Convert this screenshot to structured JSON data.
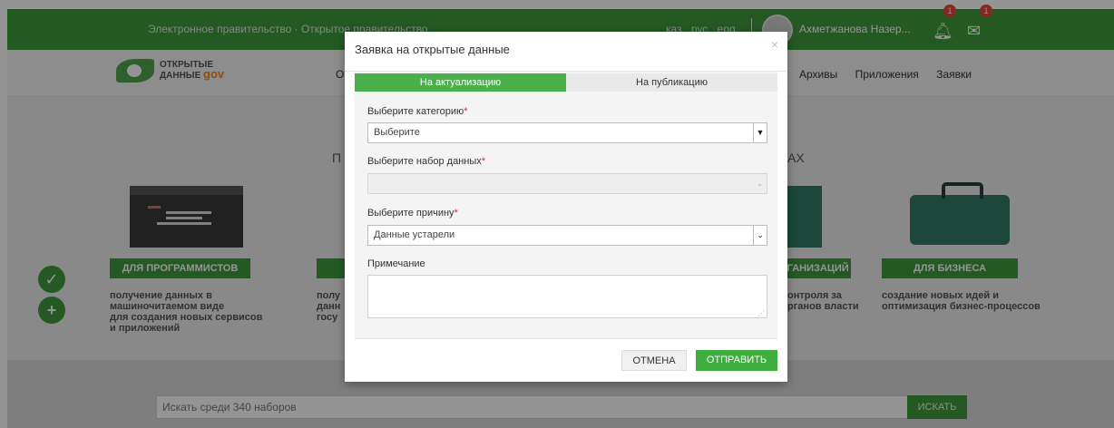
{
  "topbar": {
    "gov_text": "Электронное правительство · Открытое правительство",
    "langs": [
      "каз",
      "рус",
      "eng"
    ],
    "user_name": "Ахметжанова Назер...",
    "notifications_count": "1",
    "messages_count": "1"
  },
  "navbar": {
    "logo_line1": "ОТКРЫТЫЕ",
    "logo_line2": "ДАННЫЕ",
    "logo_suffix": "gov",
    "partial_item": "О",
    "items": [
      "Архивы",
      "Приложения",
      "Заявки"
    ]
  },
  "hero": {
    "partial_left": "П",
    "partial_right": "АХ",
    "cards": [
      {
        "label": "ДЛЯ ПРОГРАММИСТОВ",
        "desc": [
          "получение данных в",
          "машиночитаемом виде",
          "для создания новых сервисов",
          "и приложений"
        ]
      },
      {
        "label": "",
        "desc": [
          "полу",
          "данн",
          "госу"
        ]
      },
      {
        "label": "РГАНИЗАЦИЙ",
        "desc": [
          "онтроля за",
          "рганов власти"
        ]
      },
      {
        "label": "ДЛЯ БИЗНЕСА",
        "desc": [
          "создание новых идей и",
          "оптимизация бизнес-процессов"
        ]
      }
    ]
  },
  "search": {
    "placeholder": "Искать среди 340 наборов",
    "button": "ИСКАТЬ"
  },
  "modal": {
    "title": "Заявка на открытые данные",
    "close": "×",
    "tabs": [
      "На актуализацию",
      "На публикацию"
    ],
    "category_label": "Выберите категорию",
    "category_value": "Выберите",
    "dataset_label": "Выберите набор данных",
    "dataset_value": "",
    "reason_label": "Выберите причину",
    "reason_value": "Данные устарели",
    "note_label": "Примечание",
    "required_mark": "*",
    "cancel": "ОТМЕНА",
    "submit": "ОТПРАВИТЬ"
  },
  "colors": {
    "brand_green": "#3f9a3f",
    "active_tab": "#4bb04b",
    "badge": "#e5453a",
    "required": "#d9262b"
  }
}
